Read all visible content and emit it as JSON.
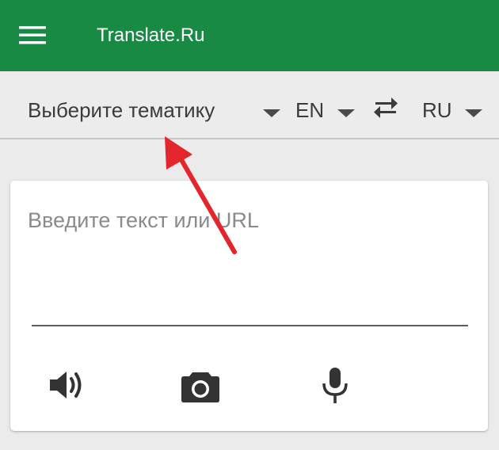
{
  "app": {
    "title": "Translate.Ru"
  },
  "toolbar": {
    "topic_label": "Выберите тематику",
    "source_language": "EN",
    "target_language": "RU"
  },
  "input": {
    "placeholder": "Введите текст или URL"
  },
  "icons": {
    "menu": "hamburger-menu-icon",
    "swap": "swap-arrows-icon",
    "speaker": "speaker-icon",
    "camera": "camera-icon",
    "microphone": "microphone-icon"
  },
  "colors": {
    "appbar": "#188a43",
    "annotation_arrow": "#e2262c"
  }
}
